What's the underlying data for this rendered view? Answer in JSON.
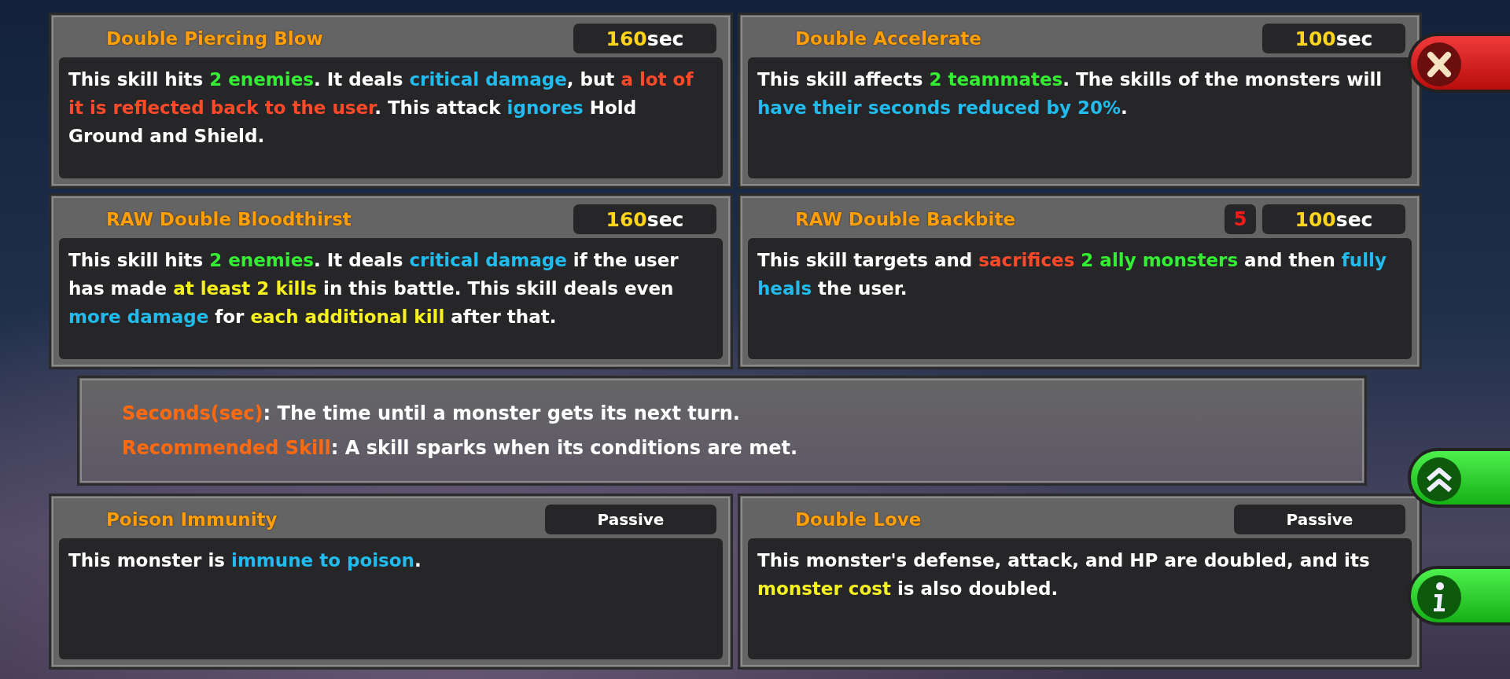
{
  "skills": [
    {
      "title": "Double Piercing Blow",
      "timer": {
        "value": "160",
        "unit": "sec"
      },
      "description": [
        {
          "text": "This skill hits ",
          "color": "#ffffff"
        },
        {
          "text": "2 enemies",
          "color": "#33ee33"
        },
        {
          "text": ". It deals ",
          "color": "#ffffff"
        },
        {
          "text": "critical damage",
          "color": "#22bbee"
        },
        {
          "text": ", but ",
          "color": "#ffffff"
        },
        {
          "text": "a lot of it is reflected back to the user",
          "color": "#ff4a2a"
        },
        {
          "text": ". This attack ",
          "color": "#ffffff"
        },
        {
          "text": "ignores",
          "color": "#22bbee"
        },
        {
          "text": " Hold Ground and Shield.",
          "color": "#ffffff"
        }
      ]
    },
    {
      "title": "Double Accelerate",
      "timer": {
        "value": "100",
        "unit": "sec"
      },
      "description": [
        {
          "text": "This skill affects ",
          "color": "#ffffff"
        },
        {
          "text": "2 teammates",
          "color": "#33ee33"
        },
        {
          "text": ". The skills of the monsters will ",
          "color": "#ffffff"
        },
        {
          "text": "have their seconds reduced by 20%",
          "color": "#22bbee"
        },
        {
          "text": ".",
          "color": "#ffffff"
        }
      ]
    },
    {
      "title": "RAW Double Bloodthirst",
      "timer": {
        "value": "160",
        "unit": "sec"
      },
      "description": [
        {
          "text": "This skill hits ",
          "color": "#ffffff"
        },
        {
          "text": "2 enemies",
          "color": "#33ee33"
        },
        {
          "text": ". It deals ",
          "color": "#ffffff"
        },
        {
          "text": "critical damage",
          "color": "#22bbee"
        },
        {
          "text": " if the user has made ",
          "color": "#ffffff"
        },
        {
          "text": "at least 2 kills",
          "color": "#f5f020"
        },
        {
          "text": " in this battle. This skill deals even ",
          "color": "#ffffff"
        },
        {
          "text": "more damage",
          "color": "#22bbee"
        },
        {
          "text": " for ",
          "color": "#ffffff"
        },
        {
          "text": "each additional kill",
          "color": "#f5f020"
        },
        {
          "text": " after that.",
          "color": "#ffffff"
        }
      ]
    },
    {
      "title": "RAW Double Backbite",
      "badge": "5",
      "timer": {
        "value": "100",
        "unit": "sec"
      },
      "description": [
        {
          "text": "This skill targets and ",
          "color": "#ffffff"
        },
        {
          "text": "sacrifices ",
          "color": "#ff4a2a"
        },
        {
          "text": "2 ally monsters",
          "color": "#33ee33"
        },
        {
          "text": " and then ",
          "color": "#ffffff"
        },
        {
          "text": "fully heals",
          "color": "#22bbee"
        },
        {
          "text": " the user.",
          "color": "#ffffff"
        }
      ]
    }
  ],
  "legend": [
    {
      "term": "Seconds(sec)",
      "text": ": The time until a monster gets its next turn."
    },
    {
      "term": "Recommended Skill",
      "text": ": A skill sparks when its conditions are met."
    }
  ],
  "passives": [
    {
      "title": "Poison Immunity",
      "tag": "Passive",
      "description": [
        {
          "text": "This monster is ",
          "color": "#ffffff"
        },
        {
          "text": "immune to poison",
          "color": "#22bbee"
        },
        {
          "text": ".",
          "color": "#ffffff"
        }
      ]
    },
    {
      "title": "Double Love",
      "tag": "Passive",
      "description": [
        {
          "text": "This monster's defense, attack, and HP are doubled, and its ",
          "color": "#ffffff"
        },
        {
          "text": "monster cost",
          "color": "#f5f020"
        },
        {
          "text": " is also doubled.",
          "color": "#ffffff"
        }
      ]
    }
  ],
  "side_buttons": [
    {
      "kind": "close"
    },
    {
      "kind": "up"
    },
    {
      "kind": "info"
    }
  ]
}
